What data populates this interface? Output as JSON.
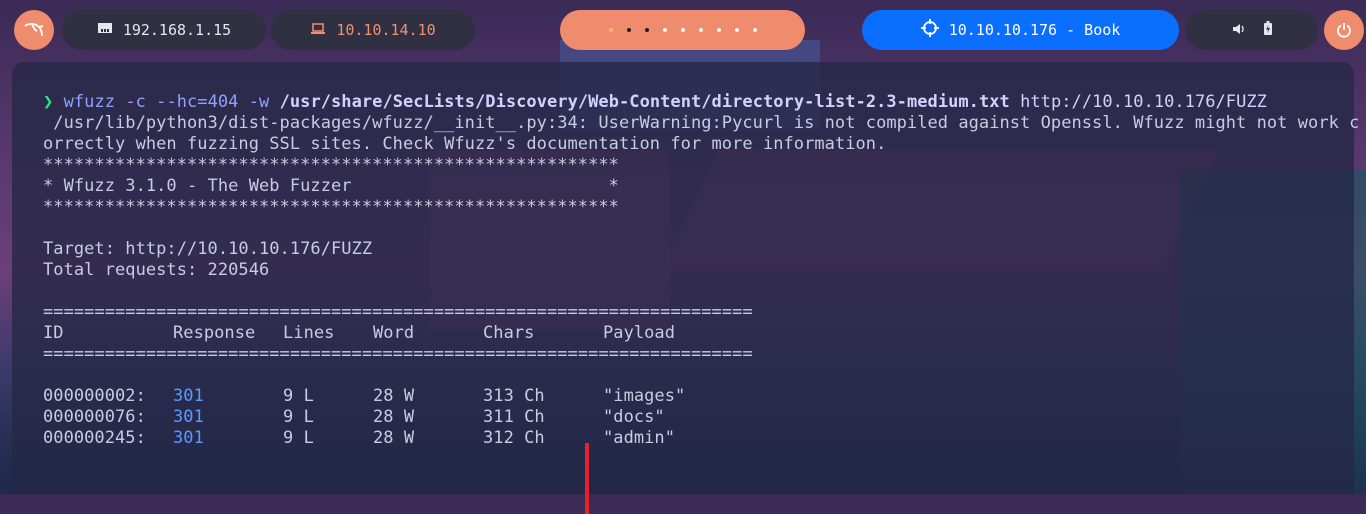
{
  "topbar": {
    "menu_icon": "kali-dragon-icon",
    "local_ip": "192.168.1.15",
    "local_ip_icon": "network-card-icon",
    "vpn_ip": "10.10.14.10",
    "vpn_ip_icon": "laptop-icon",
    "workspaces": 8,
    "active_workspace": 2,
    "target_icon": "crosshair-icon",
    "target": "10.10.10.176 - Book",
    "volume_icon": "speaker-icon",
    "battery_icon": "battery-icon",
    "power_icon": "power-icon",
    "colors": {
      "accent": "#f08c6e",
      "target_bg": "#0a6fff",
      "pill_bg": "#2f3142"
    }
  },
  "terminal": {
    "prompt_symbol": "❯",
    "command_name": "wfuzz",
    "command_flags": " -c --hc=404 -w ",
    "command_wordlist": "/usr/share/SecLists/Discovery/Web-Content/directory-list-2.3-medium.txt",
    "command_url": " http://10.10.10.176/FUZZ",
    "warning_line1": " /usr/lib/python3/dist-packages/wfuzz/__init__.py:34: UserWarning:Pycurl is not compiled against Openssl. Wfuzz might not work c",
    "warning_line2": "orrectly when fuzzing SSL sites. Check Wfuzz's documentation for more information.",
    "stars_line": "********************************************************",
    "banner_line": "* Wfuzz 3.1.0 - The Web Fuzzer                         *",
    "target_line": "Target: http://10.10.10.176/FUZZ",
    "total_line": "Total requests: 220546",
    "separator": "=====================================================================",
    "headers": [
      "ID",
      "Response",
      "Lines",
      "Word",
      "Chars",
      "Payload"
    ],
    "rows": [
      {
        "id": "000000002:",
        "response": "301",
        "lines": "9 L",
        "word": "28 W",
        "chars": "313 Ch",
        "payload": "\"images\""
      },
      {
        "id": "000000076:",
        "response": "301",
        "lines": "9 L",
        "word": "28 W",
        "chars": "311 Ch",
        "payload": "\"docs\""
      },
      {
        "id": "000000245:",
        "response": "301",
        "lines": "9 L",
        "word": "28 W",
        "chars": "312 Ch",
        "payload": "\"admin\""
      }
    ]
  }
}
